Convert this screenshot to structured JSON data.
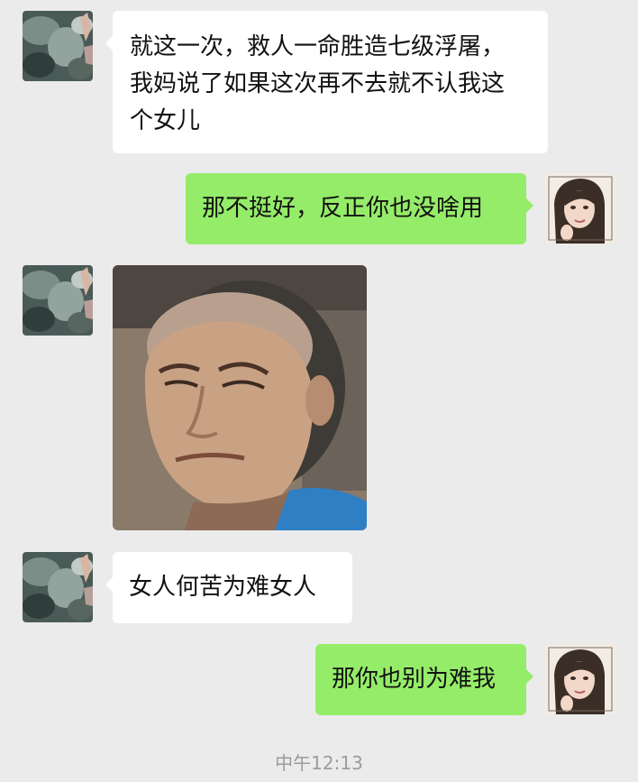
{
  "chat": {
    "messages": [
      {
        "sender": "other",
        "type": "text",
        "lines": [
          "就这一次，救人一命胜造七级浮屠，",
          "我妈说了如果这次再不去就不认我这",
          "个女儿"
        ]
      },
      {
        "sender": "me",
        "type": "text",
        "text": "那不挺好，反正你也没啥用"
      },
      {
        "sender": "other",
        "type": "image",
        "icon": "squinting-man-photo"
      },
      {
        "sender": "other",
        "type": "text",
        "text": "女人何苦为难女人"
      },
      {
        "sender": "me",
        "type": "text",
        "text": "那你也别为难我"
      }
    ],
    "timestamp": "中午12:13"
  },
  "colors": {
    "background": "#ebebeb",
    "incoming_bubble": "#ffffff",
    "outgoing_bubble": "#95ec69",
    "timestamp_text": "#9b9b9b"
  }
}
